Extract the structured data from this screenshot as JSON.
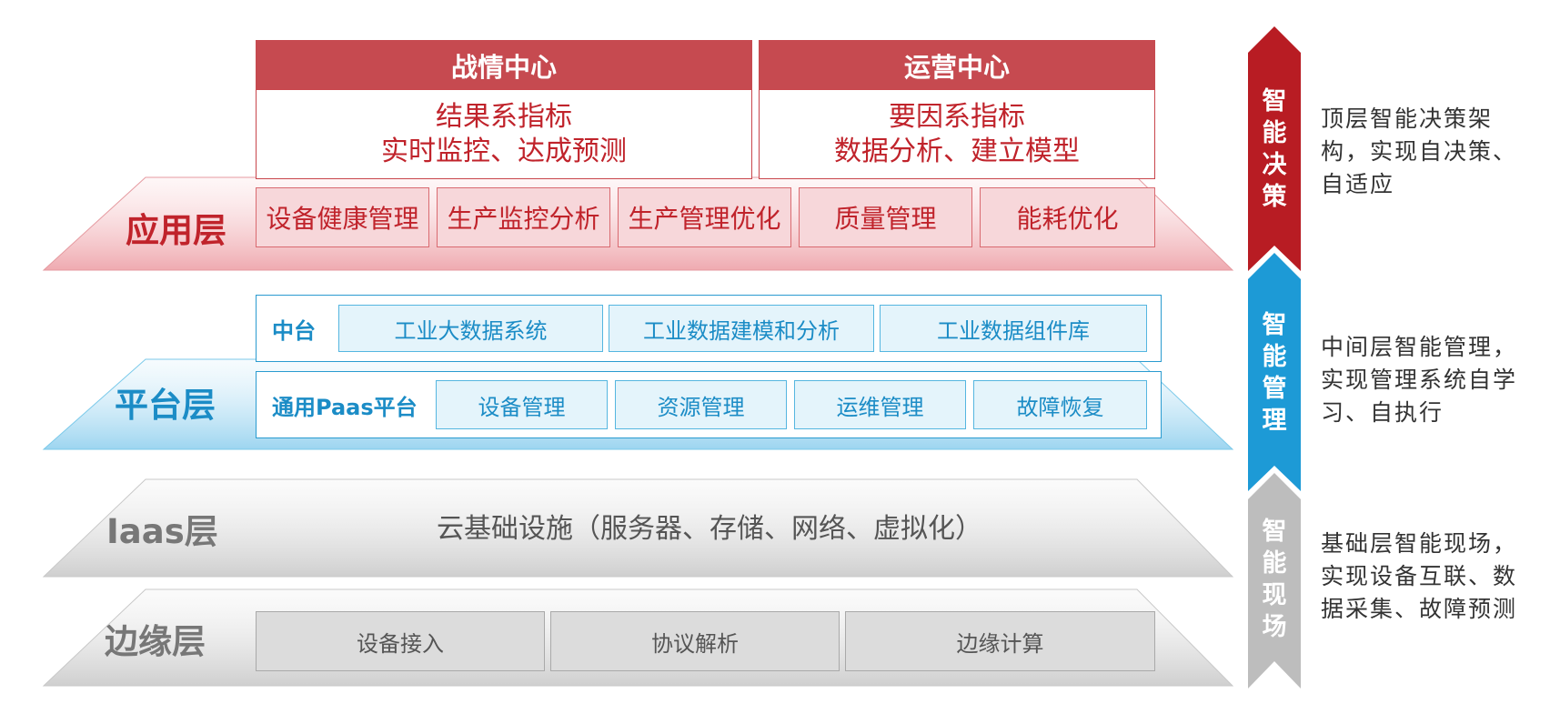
{
  "layers": {
    "application": {
      "label": "应用层",
      "centers": [
        {
          "title": "战情中心",
          "line1": "结果系指标",
          "line2": "实时监控、达成预测"
        },
        {
          "title": "运营中心",
          "line1": "要因系指标",
          "line2": "数据分析、建立模型"
        }
      ],
      "modules": [
        "设备健康管理",
        "生产监控分析",
        "生产管理优化",
        "质量管理",
        "能耗优化"
      ]
    },
    "platform": {
      "label": "平台层",
      "middle": {
        "title": "中台",
        "items": [
          "工业大数据系统",
          "工业数据建模和分析",
          "工业数据组件库"
        ]
      },
      "paas": {
        "title": "通用Paas平台",
        "items": [
          "设备管理",
          "资源管理",
          "运维管理",
          "故障恢复"
        ]
      }
    },
    "iaas": {
      "label": "Iaas层",
      "content": "云基础设施（服务器、存储、网络、虚拟化）"
    },
    "edge": {
      "label": "边缘层",
      "items": [
        "设备接入",
        "协议解析",
        "边缘计算"
      ]
    }
  },
  "side": [
    {
      "label": "智能决策",
      "desc": "顶层智能决策架构，实现自决策、自适应",
      "color": "#b81c23"
    },
    {
      "label": "智能管理",
      "desc": "中间层智能管理，实现管理系统自学习、自执行",
      "color": "#1d9ad6"
    },
    {
      "label": "智能现场",
      "desc": "基础层智能现场，实现设备互联、数据采集、故障预测",
      "color": "#bdbdbd"
    }
  ],
  "colors": {
    "app": "#c0232b",
    "platform": "#1b8cc6",
    "base": "#777777"
  }
}
